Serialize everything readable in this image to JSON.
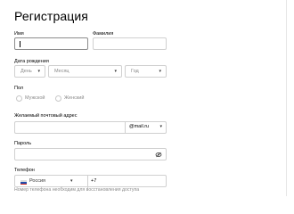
{
  "form": {
    "title": "Регистрация",
    "first_name": {
      "label": "Имя",
      "value": ""
    },
    "last_name": {
      "label": "Фамилия",
      "value": ""
    },
    "birth_date": {
      "label": "Дата рождения",
      "day": "День",
      "month": "Месяц",
      "year": "Год"
    },
    "gender": {
      "label": "Пол",
      "options": [
        "Мужской",
        "Женский"
      ]
    },
    "email": {
      "label": "Желаемый почтовый адрес",
      "value": "",
      "domain": "@mail.ru"
    },
    "password": {
      "label": "Пароль",
      "value": ""
    },
    "phone": {
      "label": "Телефон",
      "country": "Россия",
      "prefix": "+7",
      "hint": "Номер телефона необходим для восстановления доступа"
    }
  },
  "icons": {
    "chevron": "chevron-down-icon",
    "password_visibility": "eye-slash-icon",
    "flag": "russia-flag-icon"
  },
  "colors": {
    "field_border": "#d0d0d0",
    "focused_border": "#8c8c8c",
    "muted_text": "#8a8a8a",
    "flag_white": "#ffffff",
    "flag_blue": "#1f4fb0",
    "flag_red": "#d52b1e"
  }
}
